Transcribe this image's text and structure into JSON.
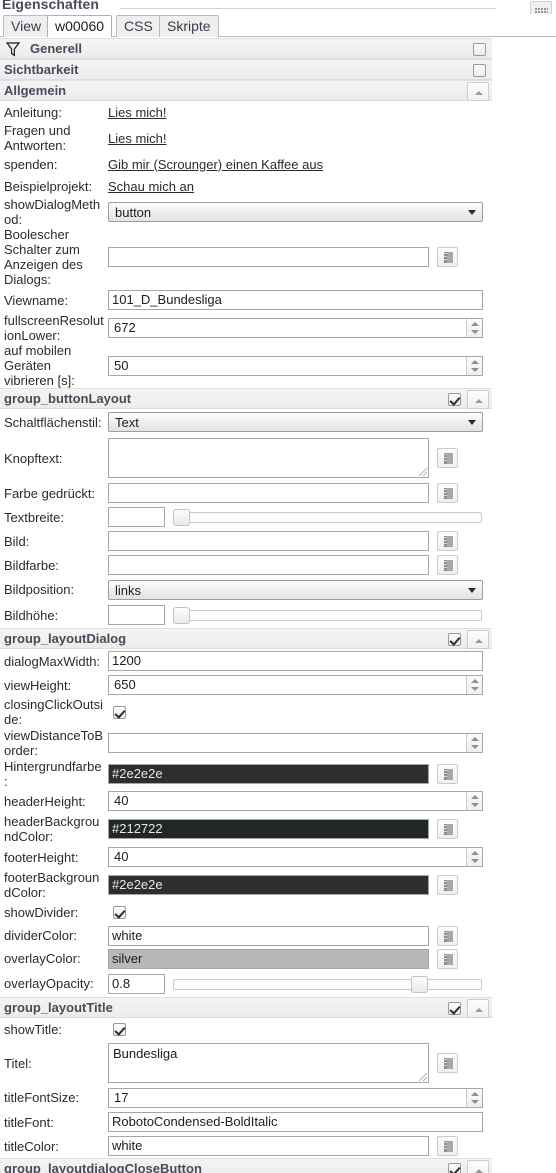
{
  "window": {
    "title": "Eigenschaften"
  },
  "tabs": [
    {
      "label": "View",
      "active": false
    },
    {
      "label": "w00060",
      "active": true
    },
    {
      "label": "CSS",
      "active": false
    },
    {
      "label": "Skripte",
      "active": false
    }
  ],
  "sections": [
    {
      "title": "Generell",
      "icon": "funnel-icon",
      "checkbox": false,
      "collapse": false
    },
    {
      "title": "Sichtbarkeit",
      "checkbox": false,
      "collapse": false
    },
    {
      "title": "Allgemein",
      "collapse": true
    },
    {
      "title": "group_buttonLayout",
      "checkbox": true,
      "collapse": true
    },
    {
      "title": "group_layoutDialog",
      "checkbox": true,
      "collapse": true
    },
    {
      "title": "group_layoutTitle",
      "checkbox": true,
      "collapse": true
    },
    {
      "title": "group_layoutdialogCloseButton",
      "checkbox": true,
      "collapse": true
    }
  ],
  "rows": {
    "anleitung": {
      "label": "Anleitung:",
      "value": "Lies mich!"
    },
    "fragen": {
      "label": "Fragen und Antworten:",
      "value": "Lies mich!"
    },
    "spenden": {
      "label": "spenden:",
      "value": "Gib mir (Scrounger) einen Kaffee aus"
    },
    "beispielprojekt": {
      "label": "Beispielprojekt:",
      "value": "Schau mich an"
    },
    "showDialogMethod": {
      "label": "showDialogMethod:",
      "value": "button"
    },
    "booleanSwitch": {
      "label": "Boolescher Schalter zum Anzeigen des Dialogs:",
      "value": ""
    },
    "viewname": {
      "label": "Viewname:",
      "value": "101_D_Bundesliga"
    },
    "fullscreenResolutionLower": {
      "label": "fullscreenResolutionLower:",
      "value": "672"
    },
    "vibrate": {
      "label": "auf mobilen Geräten vibrieren [s]:",
      "value": "50"
    },
    "schaltflaechenstil": {
      "label": "Schaltflächenstil:",
      "value": "Text"
    },
    "knopftext": {
      "label": "Knopftext:",
      "value": ""
    },
    "farbeGedrueckt": {
      "label": "Farbe gedrückt:",
      "value": ""
    },
    "textbreite": {
      "label": "Textbreite:",
      "value": "",
      "slider": 0
    },
    "bild": {
      "label": "Bild:",
      "value": ""
    },
    "bildfarbe": {
      "label": "Bildfarbe:",
      "value": ""
    },
    "bildposition": {
      "label": "Bildposition:",
      "value": "links"
    },
    "bildhoehe": {
      "label": "Bildhöhe:",
      "value": "",
      "slider": 0
    },
    "dialogMaxWidth": {
      "label": "dialogMaxWidth:",
      "value": "1200"
    },
    "viewHeight": {
      "label": "viewHeight:",
      "value": "650"
    },
    "closingClickOutside": {
      "label": "closingClickOutside:",
      "checked": true
    },
    "viewDistanceToBorder": {
      "label": "viewDistanceToBorder:",
      "value": ""
    },
    "hintergrundfarbe": {
      "label": "Hintergrundfarbe:",
      "value": "#2e2e2e",
      "color": "#2e2e2e"
    },
    "headerHeight": {
      "label": "headerHeight:",
      "value": "40"
    },
    "headerBackgroundColor": {
      "label": "headerBackgroundColor:",
      "value": "#212722",
      "color": "#212722"
    },
    "footerHeight": {
      "label": "footerHeight:",
      "value": "40"
    },
    "footerBackgroundColor": {
      "label": "footerBackgroundColor:",
      "value": "#2e2e2e",
      "color": "#2e2e2e"
    },
    "showDivider": {
      "label": "showDivider:",
      "checked": true
    },
    "dividerColor": {
      "label": "dividerColor:",
      "value": "white",
      "color": "#ffffff"
    },
    "overlayColor": {
      "label": "overlayColor:",
      "value": "silver",
      "color": "#b8b8b8"
    },
    "overlayOpacity": {
      "label": "overlayOpacity:",
      "value": "0.8",
      "slider": 80
    },
    "showTitle": {
      "label": "showTitle:",
      "checked": true
    },
    "titel": {
      "label": "Titel:",
      "value": "Bundesliga"
    },
    "titleFontSize": {
      "label": "titleFontSize:",
      "value": "17"
    },
    "titleFont": {
      "label": "titleFont:",
      "value": "RobotoCondensed-BoldItalic"
    },
    "titleColor": {
      "label": "titleColor:",
      "value": "white",
      "color": "#ffffff"
    }
  }
}
